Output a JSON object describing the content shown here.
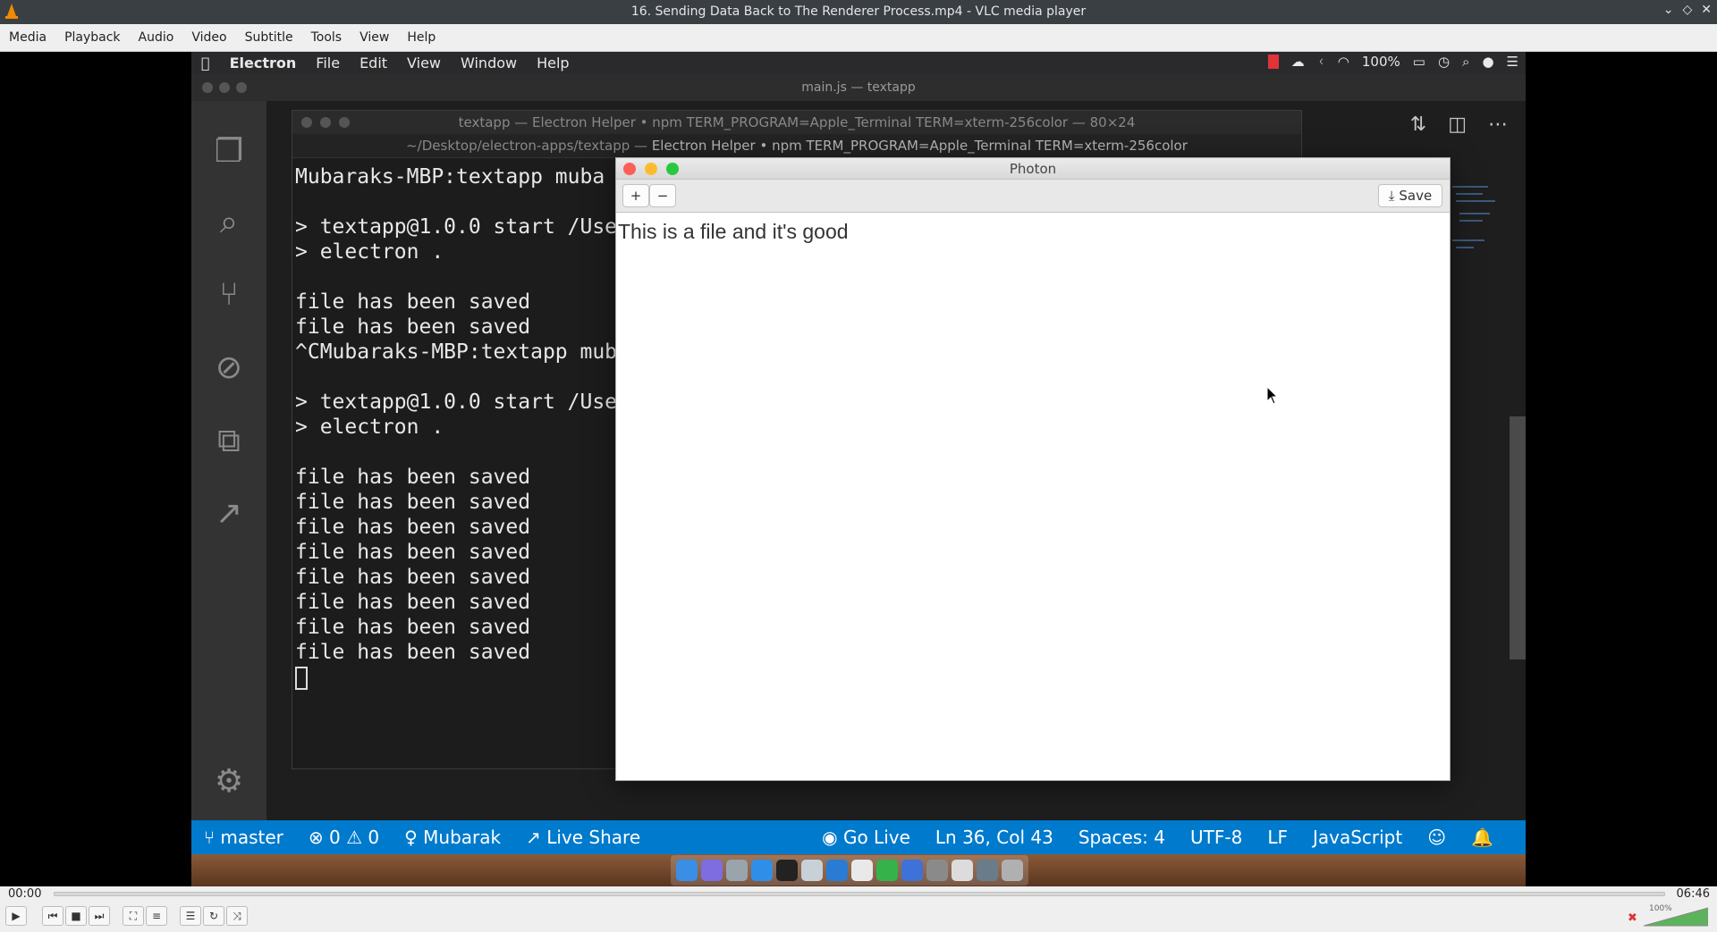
{
  "vlc": {
    "window_title": "16. Sending Data Back to The Renderer Process.mp4 - VLC media player",
    "menu": [
      "Media",
      "Playback",
      "Audio",
      "Video",
      "Subtitle",
      "Tools",
      "View",
      "Help"
    ],
    "time_elapsed": "00:00",
    "time_total": "06:46",
    "progress_fraction": 0.0,
    "volume_label": "100%",
    "volume_level": 1.0
  },
  "mac": {
    "menubar": [
      "Electron",
      "File",
      "Edit",
      "View",
      "Window",
      "Help"
    ],
    "battery": "100%"
  },
  "vscode": {
    "title": "main.js — textapp",
    "status": {
      "branch": "master",
      "errors": "0",
      "warnings": "0",
      "user": "Mubarak",
      "live_share": "Live Share",
      "go_live": "Go Live",
      "position": "Ln 36, Col 43",
      "spaces": "Spaces: 4",
      "encoding": "UTF-8",
      "eol": "LF",
      "language": "JavaScript"
    }
  },
  "terminal": {
    "title": "textapp — Electron Helper • npm TERM_PROGRAM=Apple_Terminal TERM=xterm-256color — 80×24",
    "path_prefix": "~/Desktop/electron-apps/textapp — ",
    "path_main": "Electron Helper • npm TERM_PROGRAM=Apple_Terminal TERM=xterm-256color",
    "lines": [
      "Mubaraks-MBP:textapp muba",
      "",
      "> textapp@1.0.0 start /Use",
      "> electron .",
      "",
      "file has been saved",
      "file has been saved",
      "^CMubaraks-MBP:textapp mub",
      "",
      "> textapp@1.0.0 start /Use",
      "> electron .",
      "",
      "file has been saved",
      "file has been saved",
      "file has been saved",
      "file has been saved",
      "file has been saved",
      "file has been saved",
      "file has been saved",
      "file has been saved"
    ]
  },
  "photon": {
    "title": "Photon",
    "add_label": "+",
    "remove_label": "−",
    "save_label": "Save",
    "content": "This is a file and it's good"
  }
}
